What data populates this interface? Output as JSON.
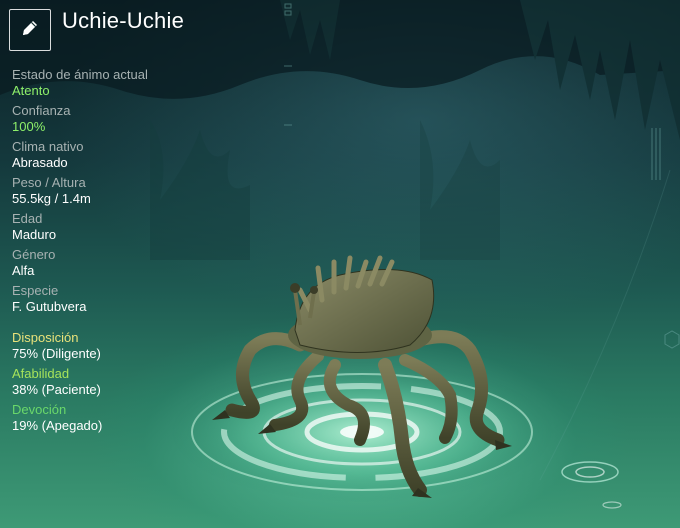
{
  "creature": {
    "name": "Uchie-Uchie"
  },
  "stats": [
    {
      "label": "Estado de ánimo actual",
      "value": "Atento"
    },
    {
      "label": "Confianza",
      "value": "100%"
    },
    {
      "label": "Clima nativo",
      "value": "Abrasado"
    },
    {
      "label": "Peso / Altura",
      "value": "55.5kg / 1.4m"
    },
    {
      "label": "Edad",
      "value": "Maduro"
    },
    {
      "label": "Género",
      "value": "Alfa"
    },
    {
      "label": "Especie",
      "value": "F. Gutubvera"
    }
  ],
  "traits": [
    {
      "label": "Disposición",
      "value": "75% (Diligente)",
      "label_color": "#e9e27a"
    },
    {
      "label": "Afabilidad",
      "value": "38% (Paciente)",
      "label_color": "#a6e35a"
    },
    {
      "label": "Devoción",
      "value": "19% (Apegado)",
      "label_color": "#6ad86a"
    }
  ],
  "colors": {
    "highlight_value": "#8ef06a",
    "label_grey": "#a7b2b2"
  },
  "icons": {
    "edit": "pencil-icon"
  }
}
